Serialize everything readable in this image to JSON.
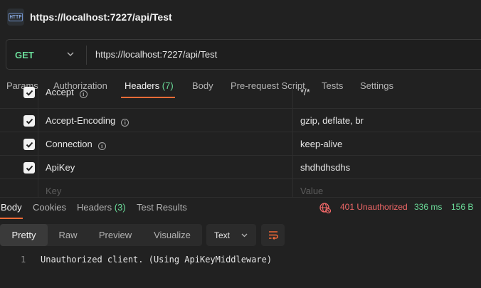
{
  "window": {
    "title": "https://localhost:7227/api/Test",
    "icon_label": "HTTP",
    "icon": "http-request-icon"
  },
  "request": {
    "method": "GET",
    "url": "https://localhost:7227/api/Test"
  },
  "request_tabs": [
    {
      "label": "Params"
    },
    {
      "label": "Authorization"
    },
    {
      "label": "Headers",
      "count": "(7)",
      "active": true
    },
    {
      "label": "Body"
    },
    {
      "label": "Pre-request Script"
    },
    {
      "label": "Tests"
    },
    {
      "label": "Settings"
    }
  ],
  "headers": {
    "rows": [
      {
        "key": "Accept",
        "value": "*/*",
        "checked": true,
        "info": true
      },
      {
        "key": "Accept-Encoding",
        "value": "gzip, deflate, br",
        "checked": true,
        "info": true
      },
      {
        "key": "Connection",
        "value": "keep-alive",
        "checked": true,
        "info": true
      },
      {
        "key": "ApiKey",
        "value": "shdhdhsdhs",
        "checked": true,
        "info": false
      }
    ],
    "key_placeholder": "Key",
    "value_placeholder": "Value"
  },
  "response_tabs": [
    {
      "label": "Body",
      "active": true
    },
    {
      "label": "Cookies"
    },
    {
      "label": "Headers",
      "count": "(3)"
    },
    {
      "label": "Test Results"
    }
  ],
  "response_status": {
    "status": "401 Unauthorized",
    "time": "336 ms",
    "size": "156 B",
    "icon": "globe-error-icon",
    "status_color": "#f06868",
    "metric_color": "#6bdd9a"
  },
  "view_modes": [
    {
      "label": "Pretty",
      "active": true
    },
    {
      "label": "Raw"
    },
    {
      "label": "Preview"
    },
    {
      "label": "Visualize"
    }
  ],
  "format": {
    "selected": "Text"
  },
  "response_body": {
    "lines": [
      {
        "number": "1",
        "text": "Unauthorized client. (Using ApiKeyMiddleware)"
      }
    ]
  },
  "colors": {
    "accent": "#ff6c37",
    "method_get": "#6bdd9a",
    "background": "#212121"
  }
}
